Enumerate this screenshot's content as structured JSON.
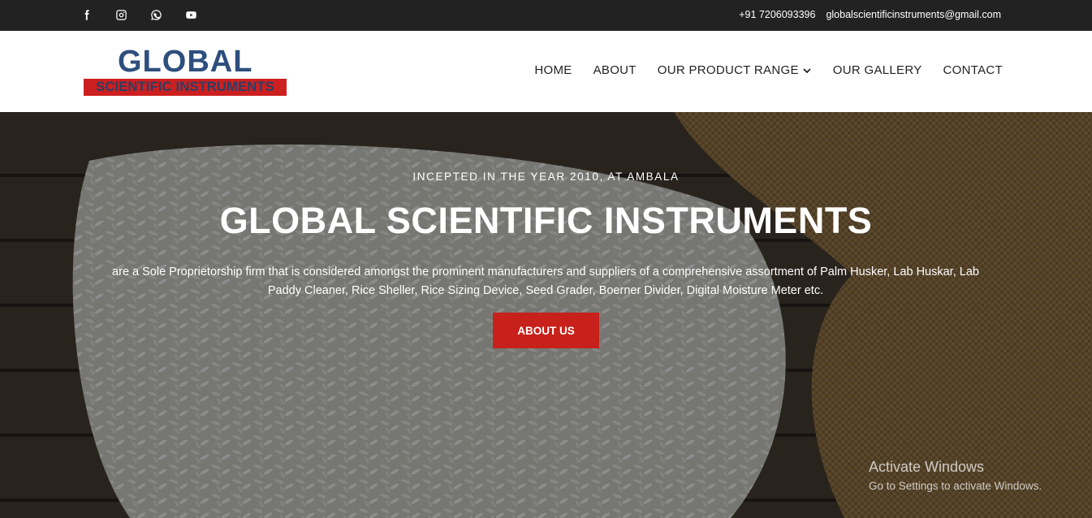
{
  "topbar": {
    "social": [
      {
        "name": "facebook-icon"
      },
      {
        "name": "instagram-icon"
      },
      {
        "name": "whatsapp-icon"
      },
      {
        "name": "youtube-icon"
      }
    ],
    "phone": "+91 7206093396",
    "email": "globalscientificinstruments@gmail.com"
  },
  "logo": {
    "line1": "GLOBAL",
    "line2": "SCIENTIFIC INSTRUMENTS"
  },
  "nav": {
    "items": [
      {
        "label": "HOME"
      },
      {
        "label": "ABOUT"
      },
      {
        "label": "OUR PRODUCT RANGE",
        "dropdown": true
      },
      {
        "label": "OUR GALLERY"
      },
      {
        "label": "CONTACT"
      }
    ]
  },
  "hero": {
    "tagline": "INCEPTED IN THE YEAR 2010, AT AMBALA",
    "title": "GLOBAL SCIENTIFIC INSTRUMENTS",
    "description": "are a Sole Proprietorship firm that is considered amongst the prominent manufacturers and suppliers of a comprehensive assortment of Palm Husker, Lab Huskar, Lab Paddy Cleaner, Rice Sheller, Rice Sizing Device, Seed Grader, Boerner Divider, Digital Moisture Meter etc.",
    "button": "ABOUT US"
  },
  "watermark": {
    "line1": "Activate Windows",
    "line2": "Go to Settings to activate Windows."
  },
  "colors": {
    "topbar": "#222222",
    "accent": "#c8201a",
    "logo_blue": "#2e4f7d"
  }
}
